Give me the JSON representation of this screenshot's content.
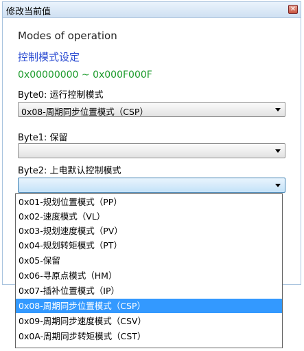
{
  "dialog": {
    "title": "修改当前值",
    "close_glyph": "✕",
    "param_name": "Modes of operation",
    "param_desc": "控制模式设定",
    "param_range": "0x00000000 ~ 0x000F000F"
  },
  "byte0": {
    "label": "Byte0: 运行控制模式",
    "value": "0x08-周期同步位置模式（CSP）"
  },
  "byte1": {
    "label": "Byte1: 保留",
    "value": ""
  },
  "byte2": {
    "label": "Byte2: 上电默认控制模式",
    "value": ""
  },
  "dropdown": {
    "selected_index": 7,
    "options": [
      "0x01-规划位置模式（PP）",
      "0x02-速度模式（VL）",
      "0x03-规划速度模式（PV）",
      "0x04-规划转矩模式（PT）",
      "0x05-保留",
      "0x06-寻原点模式（HM）",
      "0x07-插补位置模式（IP）",
      "0x08-周期同步位置模式（CSP）",
      "0x09-周期同步速度模式（CSV）",
      "0x0A-周期同步转矩模式（CST）"
    ]
  },
  "colors": {
    "accent": "#3399ff",
    "desc_blue": "#2a4bd1",
    "range_green": "#1a9a2a"
  }
}
